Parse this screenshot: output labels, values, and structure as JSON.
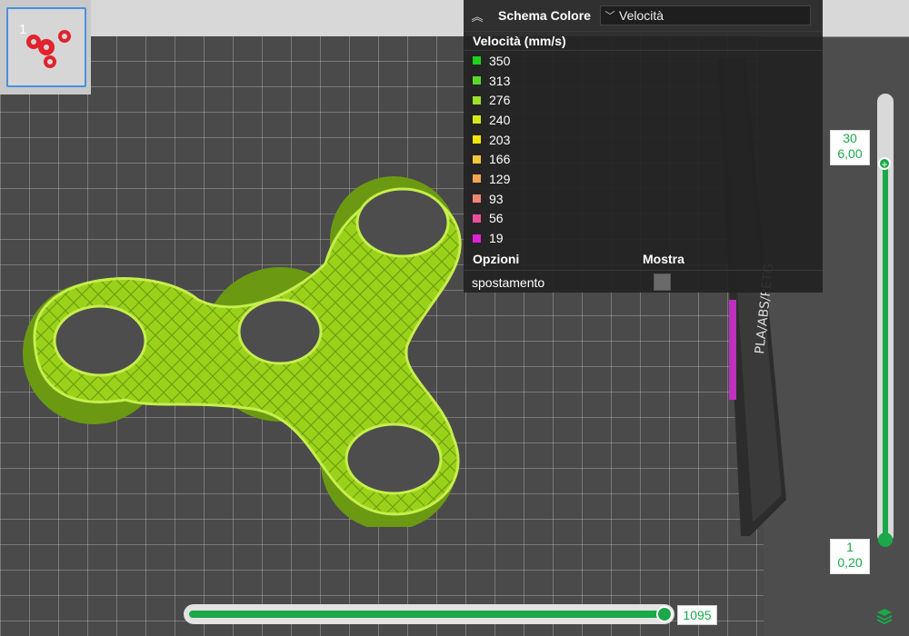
{
  "thumbnail": {
    "plate_number": "1"
  },
  "legend": {
    "header_title": "Schema Colore",
    "selected_view": "Velocità",
    "section_title": "Velocità (mm/s)",
    "items": [
      {
        "value": "350",
        "color": "#1fd21f"
      },
      {
        "value": "313",
        "color": "#5bd62a"
      },
      {
        "value": "276",
        "color": "#9ee02a"
      },
      {
        "value": "240",
        "color": "#d7e818"
      },
      {
        "value": "203",
        "color": "#f1e40d"
      },
      {
        "value": "166",
        "color": "#f5c53a"
      },
      {
        "value": "129",
        "color": "#f1a452"
      },
      {
        "value": "93",
        "color": "#ef8673"
      },
      {
        "value": "56",
        "color": "#ea4f9b"
      },
      {
        "value": "19",
        "color": "#e021d8"
      }
    ],
    "options_header": "Opzioni",
    "show_header": "Mostra",
    "options": [
      {
        "label": "spostamento",
        "checked": false
      }
    ]
  },
  "layer_slider": {
    "top_layer": "30",
    "top_height": "6,00",
    "bottom_layer": "1",
    "bottom_height": "0,20"
  },
  "move_slider": {
    "value": "1095"
  },
  "colors": {
    "accent": "#1aa84a",
    "model": "#9ad21a"
  }
}
